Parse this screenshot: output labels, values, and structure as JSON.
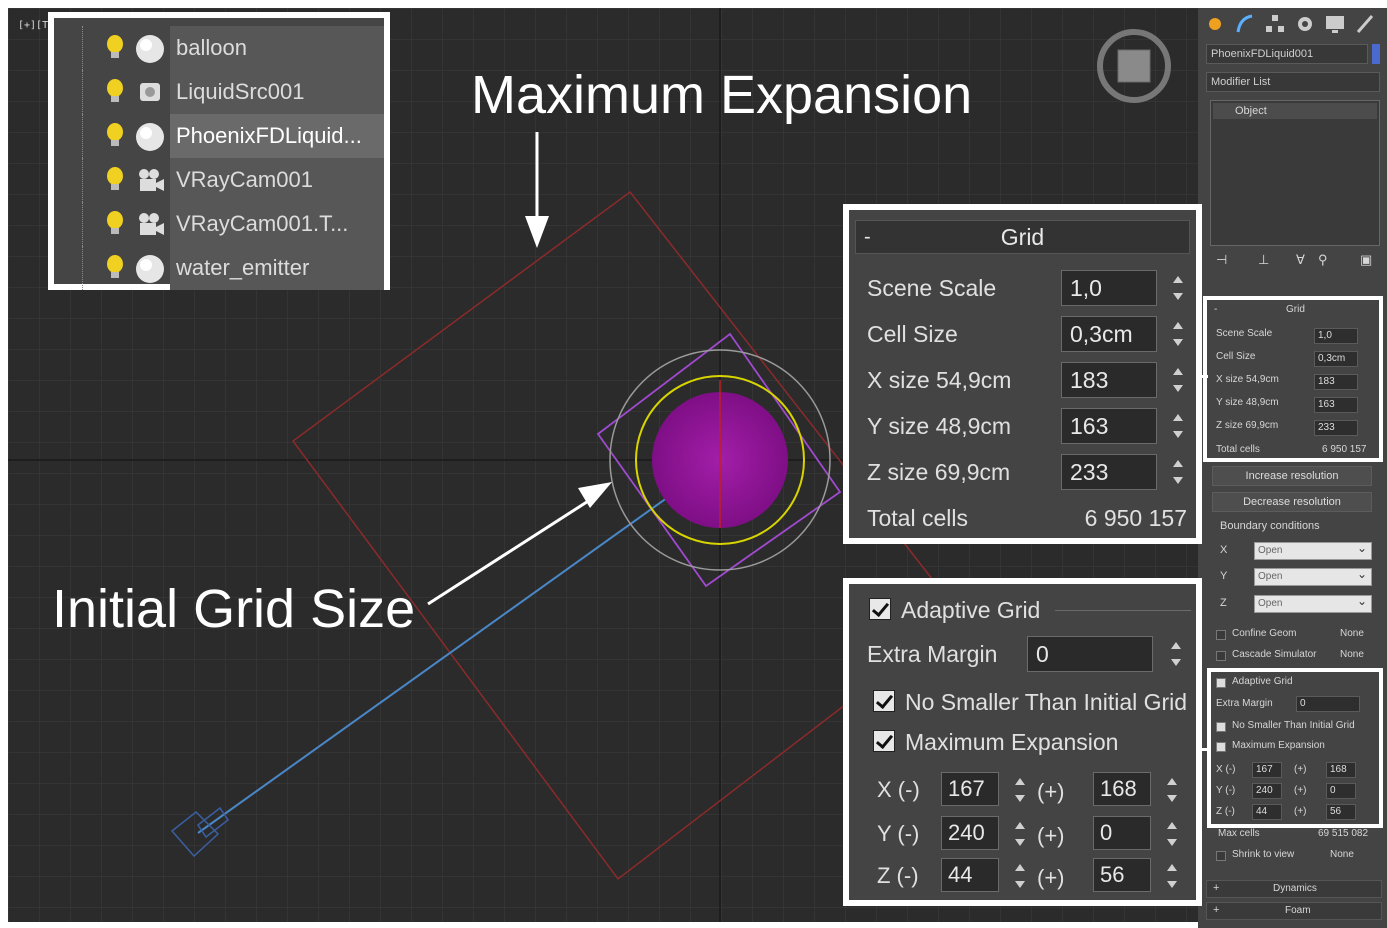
{
  "viewport": {
    "label": "[+][To"
  },
  "callouts": {
    "max_expansion": "Maximum Expansion",
    "initial_grid": "Initial Grid Size"
  },
  "outliner": {
    "items": [
      {
        "name": "balloon",
        "icon": "sphere-icon"
      },
      {
        "name": "LiquidSrc001",
        "icon": "liquid-source-icon"
      },
      {
        "name": "PhoenixFDLiquid...",
        "icon": "sphere-icon",
        "selected": true
      },
      {
        "name": "VRayCam001",
        "icon": "camera-icon"
      },
      {
        "name": "VRayCam001.T...",
        "icon": "camera-icon"
      },
      {
        "name": "water_emitter",
        "icon": "sphere-icon"
      }
    ]
  },
  "grid_panel": {
    "title": "Grid",
    "collapse": "-",
    "rows": [
      {
        "label": "Scene Scale",
        "value": "1,0"
      },
      {
        "label": "Cell Size",
        "value": "0,3cm"
      },
      {
        "label": "X size  54,9cm",
        "value": "183"
      },
      {
        "label": "Y size  48,9cm",
        "value": "163"
      },
      {
        "label": "Z size  69,9cm",
        "value": "233"
      }
    ],
    "total_label": "Total cells",
    "total_value": "6 950 157"
  },
  "adaptive_panel": {
    "adaptive_label": "Adaptive Grid",
    "extra_margin_label": "Extra Margin",
    "extra_margin_value": "0",
    "no_smaller_label": "No Smaller Than Initial Grid",
    "max_expansion_label": "Maximum Expansion",
    "axes": [
      {
        "label": "X (-)",
        "minus": "167",
        "plus_label": "(+)",
        "plus": "168"
      },
      {
        "label": "Y (-)",
        "minus": "240",
        "plus_label": "(+)",
        "plus": "0"
      },
      {
        "label": "Z (-)",
        "minus": "44",
        "plus_label": "(+)",
        "plus": "56"
      }
    ]
  },
  "command_panel": {
    "object_name": "PhoenixFDLiquid001",
    "modifier_list": "Modifier List",
    "stack_item": "Object",
    "grid": {
      "title": "Grid",
      "rows": [
        {
          "label": "Scene Scale",
          "value": "1,0"
        },
        {
          "label": "Cell Size",
          "value": "0,3cm"
        },
        {
          "label": "X size  54,9cm",
          "value": "183"
        },
        {
          "label": "Y size  48,9cm",
          "value": "163"
        },
        {
          "label": "Z size  69,9cm",
          "value": "233"
        }
      ],
      "total_label": "Total cells",
      "total_value": "6 950 157"
    },
    "increase": "Increase resolution",
    "decrease": "Decrease resolution",
    "boundary_title": "Boundary conditions",
    "boundary": [
      {
        "axis": "X",
        "value": "Open"
      },
      {
        "axis": "Y",
        "value": "Open"
      },
      {
        "axis": "Z",
        "value": "Open"
      }
    ],
    "confine_geom": "Confine Geom",
    "confine_value": "None",
    "cascade": "Cascade Simulator",
    "cascade_value": "None",
    "adaptive": {
      "label": "Adaptive Grid",
      "extra_margin": "Extra Margin",
      "extra_value": "0",
      "no_smaller": "No Smaller Than Initial Grid",
      "max_exp": "Maximum Expansion",
      "axes": [
        {
          "label": "X (-)",
          "minus": "167",
          "plus_label": "(+)",
          "plus": "168"
        },
        {
          "label": "Y (-)",
          "minus": "240",
          "plus_label": "(+)",
          "plus": "0"
        },
        {
          "label": "Z (-)",
          "minus": "44",
          "plus_label": "(+)",
          "plus": "56"
        }
      ]
    },
    "max_cells_label": "Max cells",
    "max_cells_value": "69 515 082",
    "shrink_label": "Shrink to view",
    "shrink_value": "None",
    "dynamics": "Dynamics",
    "foam": "Foam"
  }
}
